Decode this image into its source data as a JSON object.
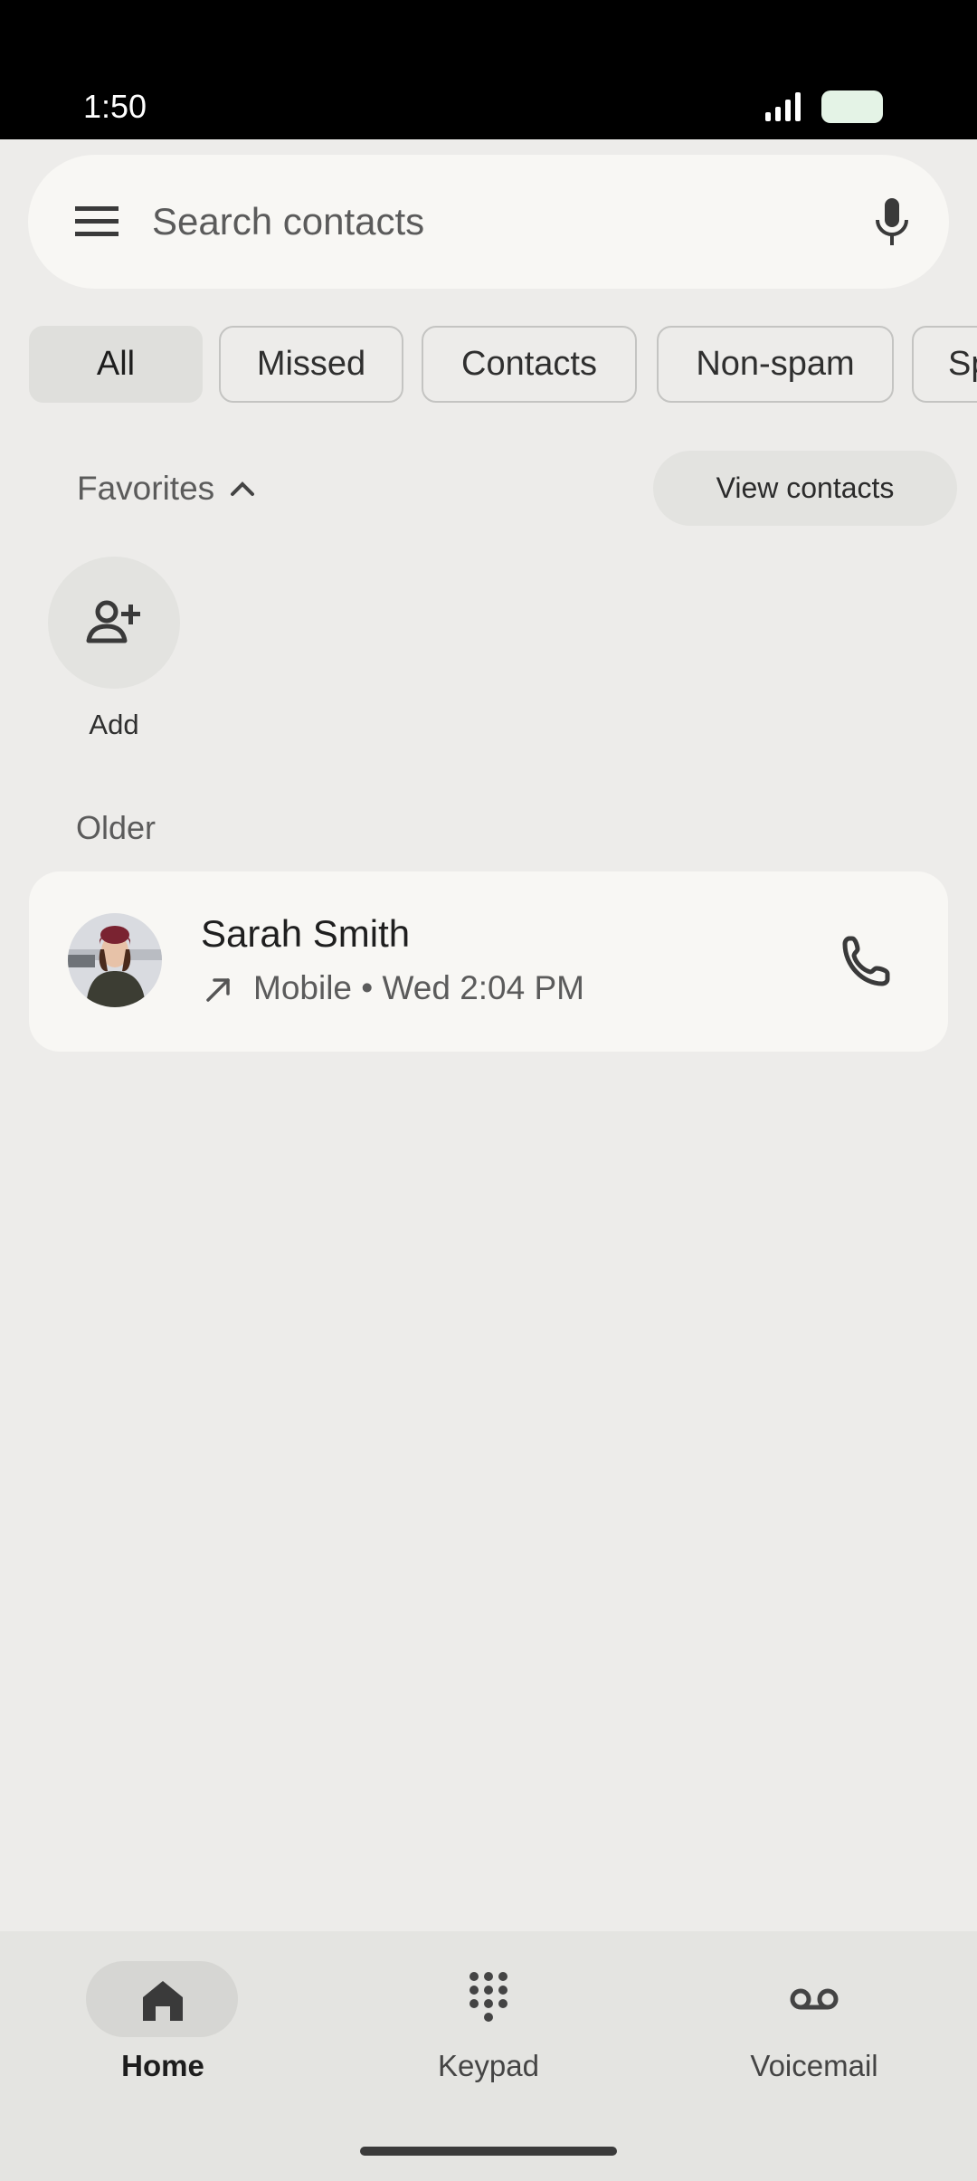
{
  "status_bar": {
    "time": "1:50"
  },
  "search": {
    "placeholder": "Search contacts"
  },
  "filters": [
    {
      "label": "All",
      "selected": true
    },
    {
      "label": "Missed",
      "selected": false
    },
    {
      "label": "Contacts",
      "selected": false
    },
    {
      "label": "Non-spam",
      "selected": false
    },
    {
      "label": "Sp",
      "selected": false
    }
  ],
  "favorites": {
    "label": "Favorites",
    "view_contacts_label": "View contacts",
    "add_label": "Add"
  },
  "sections": {
    "older_label": "Older"
  },
  "calls": [
    {
      "name": "Sarah Smith",
      "details": "Mobile • Wed 2:04 PM",
      "direction": "outgoing"
    }
  ],
  "bottom_nav": [
    {
      "label": "Home",
      "icon": "home-icon",
      "active": true
    },
    {
      "label": "Keypad",
      "icon": "keypad-icon",
      "active": false
    },
    {
      "label": "Voicemail",
      "icon": "voicemail-icon",
      "active": false
    }
  ],
  "colors": {
    "accent": "#1f1f1f",
    "background": "#edecea",
    "card": "#f8f7f4"
  }
}
